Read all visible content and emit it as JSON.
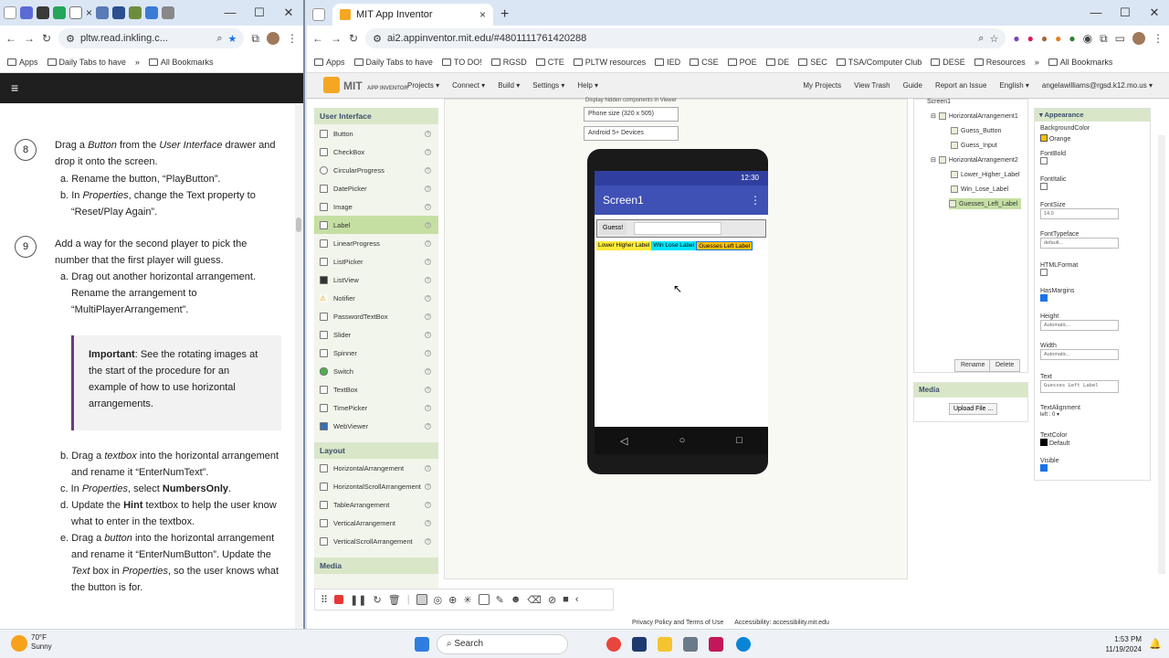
{
  "left_browser": {
    "tab_close": "×",
    "address": "pltw.read.inkling.c...",
    "bookmarks": [
      "Apps",
      "Daily Tabs to have"
    ],
    "bookmarks_more": "»",
    "all_bookmarks": "All Bookmarks",
    "reader_menu_icon": "≡",
    "steps": [
      {
        "number": "8"
      },
      {
        "number": "9"
      }
    ],
    "step8": {
      "p1": "Drag a ",
      "p1b": "Button",
      "p1c": " from the ",
      "p1d": "User Interface",
      "p1e": " drawer and drop it onto the screen.",
      "a": "a. Rename the button, “PlayButton”.",
      "b1": "b. In ",
      "b2": "Properties",
      "b3": ", change the Text property to “Reset/Play Again”."
    },
    "step9": {
      "p1": "Add a way for the second player to pick the number that the first player will guess.",
      "a": "a. Drag out another horizontal arrangement. Rename the arrangement to “MultiPlayerArrangement”.",
      "important_label": "Important",
      "important_text": ": See the rotating images at the start of the procedure for an example of how to use horizontal arrangements.",
      "b1": "b. Drag a ",
      "b2": "textbox",
      "b3": " into the horizontal arrangement and rename it “EnterNumText”.",
      "c1": "c. In ",
      "c2": "Properties",
      "c3": ", select ",
      "c4": "NumbersOnly",
      "c5": ".",
      "d1": "d. Update the ",
      "d2": "Hint",
      "d3": " textbox to help the user know what to enter in the textbox.",
      "e1": "e. Drag a ",
      "e2": "button",
      "e3": " into the horizontal arrangement and rename it “EnterNumButton”. Update the ",
      "e4": "Text",
      "e5": " box in ",
      "e6": "Properties",
      "e7": ", so the user knows what the button is for."
    }
  },
  "right_browser": {
    "tab_title": "MIT App Inventor",
    "tab_close": "×",
    "new_tab": "+",
    "address": "ai2.appinventor.mit.edu/#4801111761420288",
    "bookmarks": [
      "Apps",
      "Daily Tabs to have",
      "TO DO!",
      "RGSD",
      "CTE",
      "PLTW resources",
      "IED",
      "CSE",
      "POE",
      "DE",
      "SEC",
      "TSA/Computer Club",
      "DESE",
      "Resources"
    ],
    "bookmarks_more": "»",
    "all_bookmarks": "All Bookmarks",
    "window_controls": [
      "—",
      "☐",
      "✕"
    ]
  },
  "ai": {
    "logo_line1": "MIT",
    "logo_line2": "APP INVENTOR",
    "menu": [
      "Projects ▾",
      "Connect ▾",
      "Build ▾",
      "Settings ▾",
      "Help ▾"
    ],
    "right_menu": [
      "My Projects",
      "View Trash",
      "Guide",
      "Report an Issue",
      "English ▾",
      "angelawilliams@rgsd.k12.mo.us ▾"
    ],
    "palette_ui_header": "User Interface",
    "palette_ui": [
      "Button",
      "CheckBox",
      "CircularProgress",
      "DatePicker",
      "Image",
      "Label",
      "LinearProgress",
      "ListPicker",
      "ListView",
      "Notifier",
      "PasswordTextBox",
      "Slider",
      "Spinner",
      "Switch",
      "TextBox",
      "TimePicker",
      "WebViewer"
    ],
    "palette_selected": "Label",
    "palette_layout_header": "Layout",
    "palette_layout": [
      "HorizontalArrangement",
      "HorizontalScrollArrangement",
      "TableArrangement",
      "VerticalArrangement",
      "VerticalScrollArrangement"
    ],
    "palette_media_header": "Media",
    "help_glyph": "?",
    "viewer": {
      "hidden_label": "Display hidden components in Viewer",
      "size_select": "Phone size (320 x 505)",
      "device_select": "Android 5+ Devices",
      "time": "12:30",
      "screen_title": "Screen1",
      "menu_dots": "⋮",
      "guess_button": "Guess!",
      "label_lower_higher": "Lower Higher Label",
      "label_win_lose": "Win Lose Label",
      "label_guesses_left": "Guesses Left Label",
      "nav_back": "◁",
      "nav_home": "○",
      "nav_recent": "□"
    },
    "tree": {
      "root": "Screen1",
      "items": [
        {
          "label": "HorizontalArrangement1",
          "level": 1
        },
        {
          "label": "Guess_Button",
          "level": 2
        },
        {
          "label": "Guess_Input",
          "level": 2
        },
        {
          "label": "HorizontalArrangement2",
          "level": 1
        },
        {
          "label": "Lower_Higher_Label",
          "level": 2
        },
        {
          "label": "Win_Lose_Label",
          "level": 2
        },
        {
          "label": "Guesses_Left_Label",
          "level": 2
        }
      ],
      "selected": "Guesses_Left_Label",
      "rename": "Rename",
      "delete": "Delete"
    },
    "media": {
      "header": "Media",
      "upload": "Upload File ..."
    },
    "props": {
      "header": "Appearance",
      "bgcolor_label": "BackgroundColor",
      "bgcolor_value": "Orange",
      "fontbold_label": "FontBold",
      "fontitalic_label": "FontItalic",
      "fontsize_label": "FontSize",
      "fontsize_value": "14.0",
      "typeface_label": "FontTypeface",
      "typeface_value": "default...",
      "htmlformat_label": "HTMLFormat",
      "hasmargins_label": "HasMargins",
      "height_label": "Height",
      "height_value": "Automatic...",
      "width_label": "Width",
      "width_value": "Automatic...",
      "text_label": "Text",
      "text_value": "Guesses Left Label",
      "align_label": "TextAlignment",
      "align_value": "left : 0 ▾",
      "textcolor_label": "TextColor",
      "textcolor_value": "Default",
      "visible_label": "Visible",
      "help_glyph": "?"
    },
    "footer_privacy": "Privacy Policy and Terms of Use",
    "footer_accessibility": "Accessibility: accessibility.mit.edu"
  },
  "taskbar": {
    "weather_temp": "70°F",
    "weather_desc": "Sunny",
    "search": "Search",
    "time": "1:53 PM",
    "date": "11/19/2024"
  },
  "colors": {
    "accent_blue": "#3f51b5",
    "label_yellow": "#ffeb3b",
    "label_cyan": "#00e5ff",
    "label_orange": "#ffc107"
  }
}
